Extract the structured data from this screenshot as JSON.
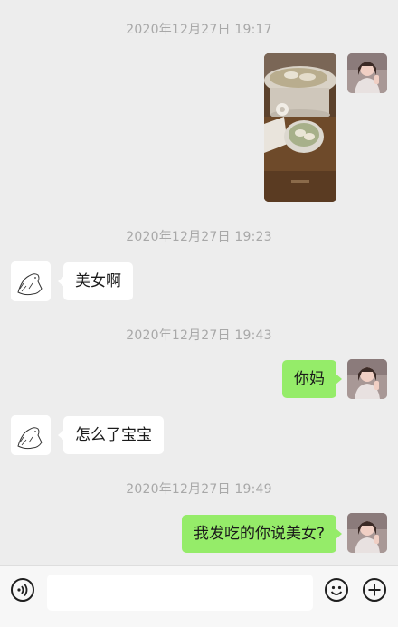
{
  "messages": {
    "ts1": "2020年12月27日 19:17",
    "ts2": "2020年12月27日 19:23",
    "msg_meinv": "美女啊",
    "ts3": "2020年12月27日 19:43",
    "msg_nima": "你妈",
    "msg_zenme": "怎么了宝宝",
    "ts4": "2020年12月27日 19:49",
    "msg_fachi": "我发吃的你说美女?"
  },
  "input": {
    "value": "",
    "placeholder": ""
  },
  "icons": {
    "voice": "voice-icon",
    "emoji": "emoji-icon",
    "plus": "plus-icon",
    "friend_avatar": "seal-sketch-avatar",
    "my_avatar": "girl-photo-avatar"
  },
  "colors": {
    "background": "#ededed",
    "outgoing_bubble": "#95ec69",
    "incoming_bubble": "#ffffff",
    "timestamp_text": "#a8a8a8"
  }
}
